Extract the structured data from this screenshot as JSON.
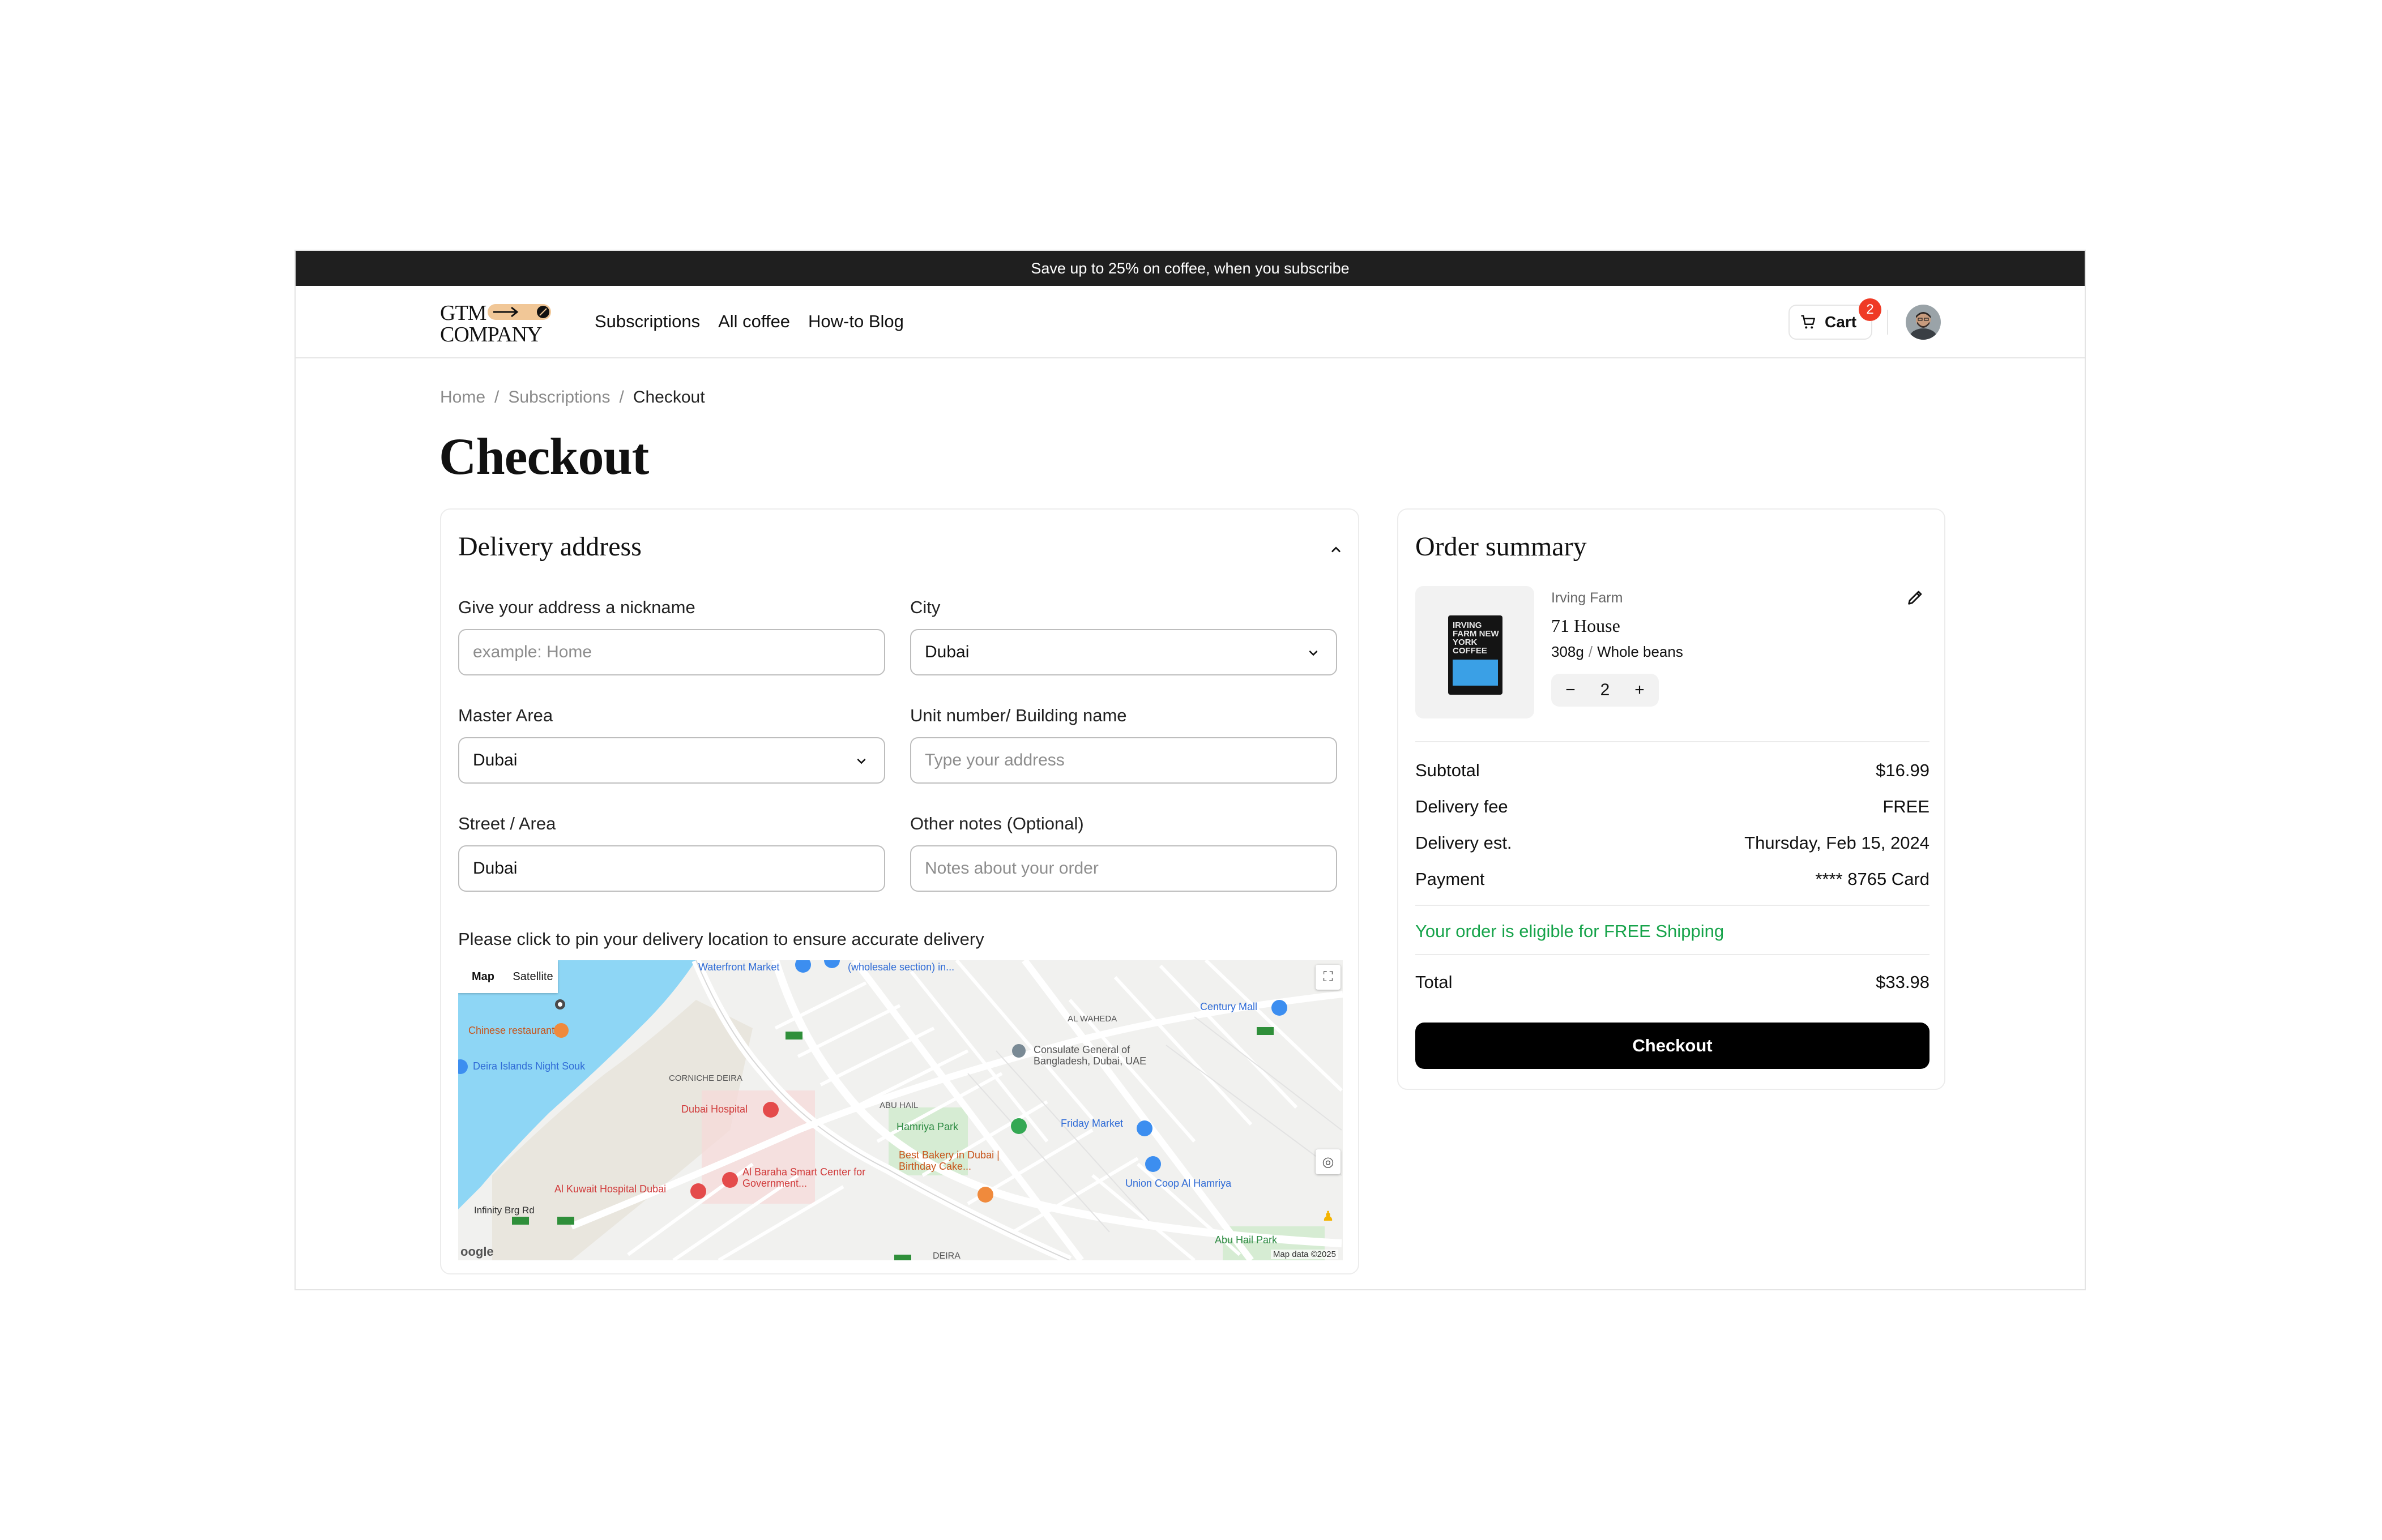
{
  "promo": {
    "text": "Save up to 25% on coffee, when you subscribe"
  },
  "brand": {
    "line1": "GTM",
    "line2": "COMPANY"
  },
  "nav": {
    "links": [
      "Subscriptions",
      "All coffee",
      "How-to Blog"
    ]
  },
  "cart": {
    "label": "Cart",
    "count": "2",
    "icon": "cart-icon"
  },
  "breadcrumb": {
    "items": [
      "Home",
      "Subscriptions",
      "Checkout"
    ],
    "separator": "/"
  },
  "page": {
    "title": "Checkout"
  },
  "delivery": {
    "title": "Delivery address",
    "fields": {
      "nickname": {
        "label": "Give your address a nickname",
        "placeholder": "example: Home"
      },
      "city": {
        "label": "City",
        "value": "Dubai"
      },
      "master_area": {
        "label": "Master Area",
        "value": "Dubai"
      },
      "unit": {
        "label": "Unit number/ Building name",
        "placeholder": "Type your address"
      },
      "street": {
        "label": "Street / Area",
        "value": "Dubai"
      },
      "notes": {
        "label": "Other notes (Optional)",
        "placeholder": "Notes about your order"
      }
    },
    "pin_note": "Please click to pin your delivery location to ensure accurate delivery",
    "map": {
      "tabs": [
        "Map",
        "Satellite"
      ],
      "credit": "Map data ©2025",
      "labels": {
        "waterfront": "Waterfront Market",
        "wholesale": "(wholesale section) in...",
        "chinese": "Chinese restaurant",
        "night_souk": "Deira Islands Night Souk",
        "corniche": "CORNICHE DEIRA",
        "dubai_hospital": "Dubai Hospital",
        "al_waheda": "AL WAHEDA",
        "consulate": "Consulate General of Bangladesh, Dubai, UAE",
        "century_mall": "Century Mall",
        "abu_hail": "ABU HAIL",
        "hamriya_park": "Hamriya Park",
        "friday_market": "Friday Market",
        "best_bakery": "Best Bakery in Dubai | Birthday Cake...",
        "al_baraha": "Al Baraha Smart Center for Government...",
        "kuwait_hospital": "Al Kuwait Hospital Dubai",
        "union_coop": "Union Coop Al Hamriya",
        "infinity": "Infinity Brg Rd",
        "abu_hail_park": "Abu Hail Park",
        "deira": "DEIRA"
      }
    }
  },
  "summary": {
    "title": "Order summary",
    "product": {
      "brand": "Irving Farm",
      "name": "71 House",
      "weight": "308g",
      "grind": "Whole beans",
      "qty": "2",
      "bag_text": "IRVING FARM NEW YORK COFFEE"
    },
    "rows": [
      {
        "label": "Subtotal",
        "value": "$16.99"
      },
      {
        "label": "Delivery fee",
        "value": "FREE"
      },
      {
        "label": "Delivery est.",
        "value": "Thursday, Feb 15, 2024"
      },
      {
        "label": "Payment",
        "value": "**** 8765 Card"
      }
    ],
    "eligible": "Your order is eligible for FREE Shipping",
    "total": {
      "label": "Total",
      "value": "$33.98"
    },
    "button": "Checkout"
  },
  "colors": {
    "accent_green": "#16a34a",
    "badge_red": "#ef3a25",
    "promo_bg": "#1f1f1f",
    "water": "#8ed6f5"
  }
}
